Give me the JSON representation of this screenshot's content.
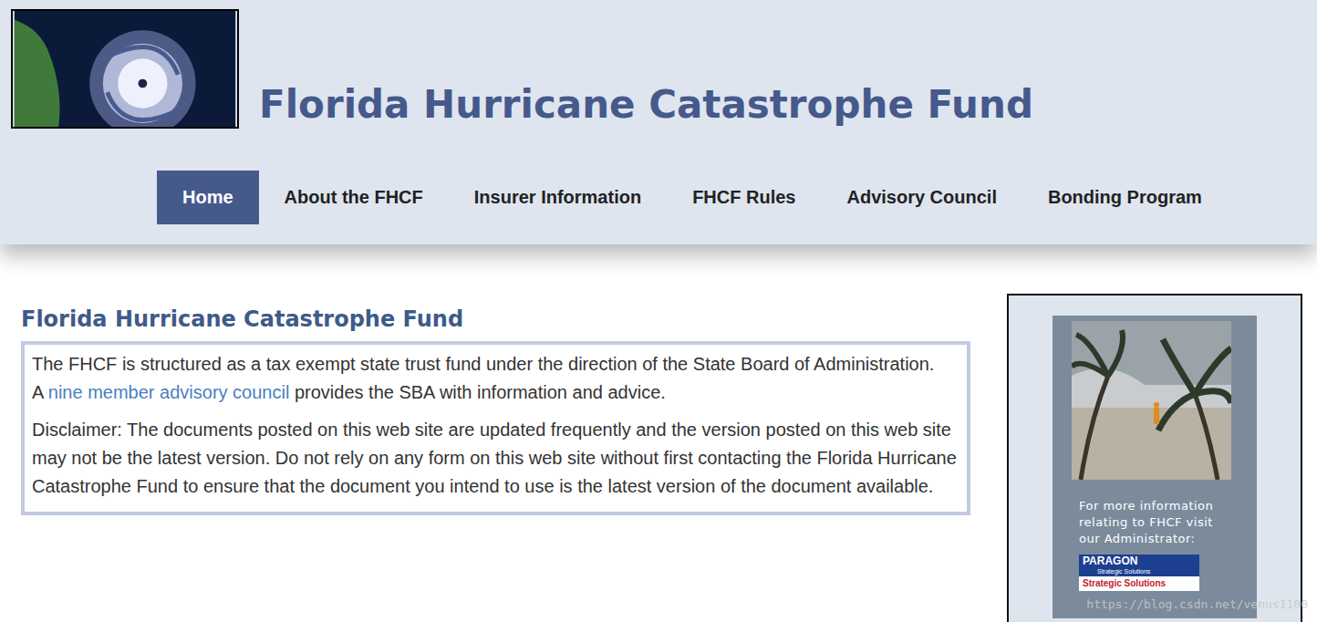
{
  "header": {
    "title": "Florida Hurricane Catastrophe Fund"
  },
  "nav": [
    {
      "label": "Home",
      "selected": true
    },
    {
      "label": "About the FHCF",
      "selected": false
    },
    {
      "label": "Insurer Information",
      "selected": false
    },
    {
      "label": "FHCF Rules",
      "selected": false
    },
    {
      "label": "Advisory Council",
      "selected": false
    },
    {
      "label": "Bonding Program",
      "selected": false
    }
  ],
  "main": {
    "heading": "Florida Hurricane Catastrophe Fund",
    "intro": "The FHCF is structured as a tax exempt state trust fund under the direction of the State Board of Administration.",
    "council": {
      "prefix": "A ",
      "link": "nine member advisory council",
      "suffix": " provides the SBA with information and advice."
    },
    "disclaimer": "Disclaimer: The documents posted on this web site are updated frequently and the version posted on this web site may not be the latest version. Do not rely on any form on this web site without first contacting the Florida Hurricane Catastrophe Fund to ensure that the document you intend to use is the latest version of the document available."
  },
  "sidebar": {
    "caption": "For more information relating to FHCF visit our Administrator:",
    "logo": {
      "name": "PARAGON",
      "tagline": "Strategic Solutions",
      "banner": "Strategic Solutions"
    }
  },
  "watermark": "https://blog.csdn.net/venus1100"
}
